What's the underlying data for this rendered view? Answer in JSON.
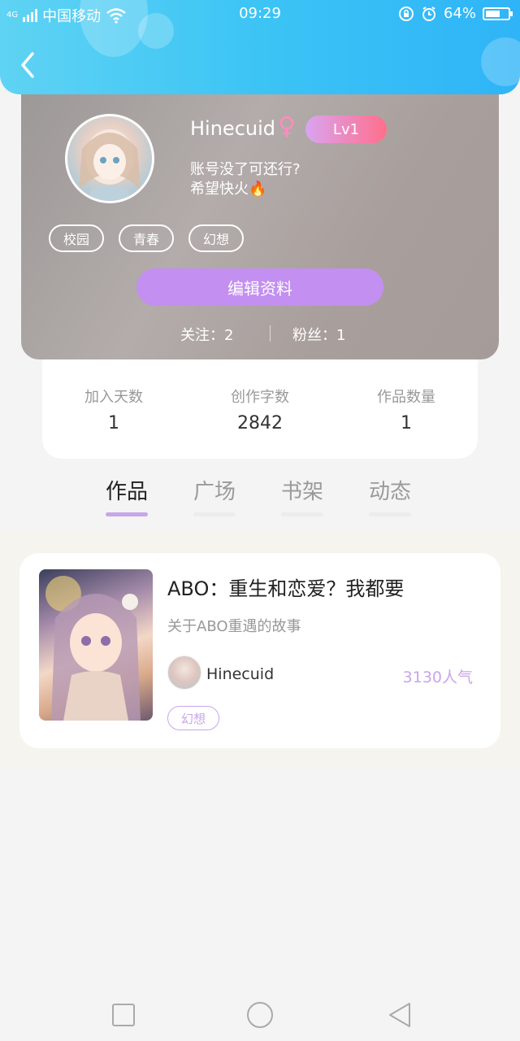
{
  "status_bar": {
    "network": "4G",
    "carrier": "中国移动",
    "time": "09:29",
    "battery": "64%",
    "battery_level": 0.64
  },
  "profile": {
    "username": "Hinecuid",
    "gender_symbol": "♀",
    "level": "Lv1",
    "bio_line1": "账号没了可还行?",
    "bio_line2": "希望快火🔥",
    "tags": [
      "校园",
      "青春",
      "幻想"
    ],
    "edit_button": "编辑资料",
    "following": "关注：2",
    "fans": "粉丝：1"
  },
  "stats": [
    {
      "label": "加入天数",
      "value": "1"
    },
    {
      "label": "创作字数",
      "value": "2842"
    },
    {
      "label": "作品数量",
      "value": "1"
    }
  ],
  "tabs": [
    {
      "label": "作品",
      "active": true
    },
    {
      "label": "广场",
      "active": false
    },
    {
      "label": "书架",
      "active": false
    },
    {
      "label": "动态",
      "active": false
    }
  ],
  "work": {
    "title": "ABO：重生和恋爱？我都要",
    "description": "关于ABO重遇的故事",
    "author": "Hinecuid",
    "popularity": "3130人气",
    "tag": "幻想"
  },
  "colors": {
    "header_gradient_start": "#5fd3f3",
    "header_gradient_end": "#2fb4f7",
    "accent_purple": "#c38ff0",
    "level_gradient_end": "#ff6f8b"
  }
}
